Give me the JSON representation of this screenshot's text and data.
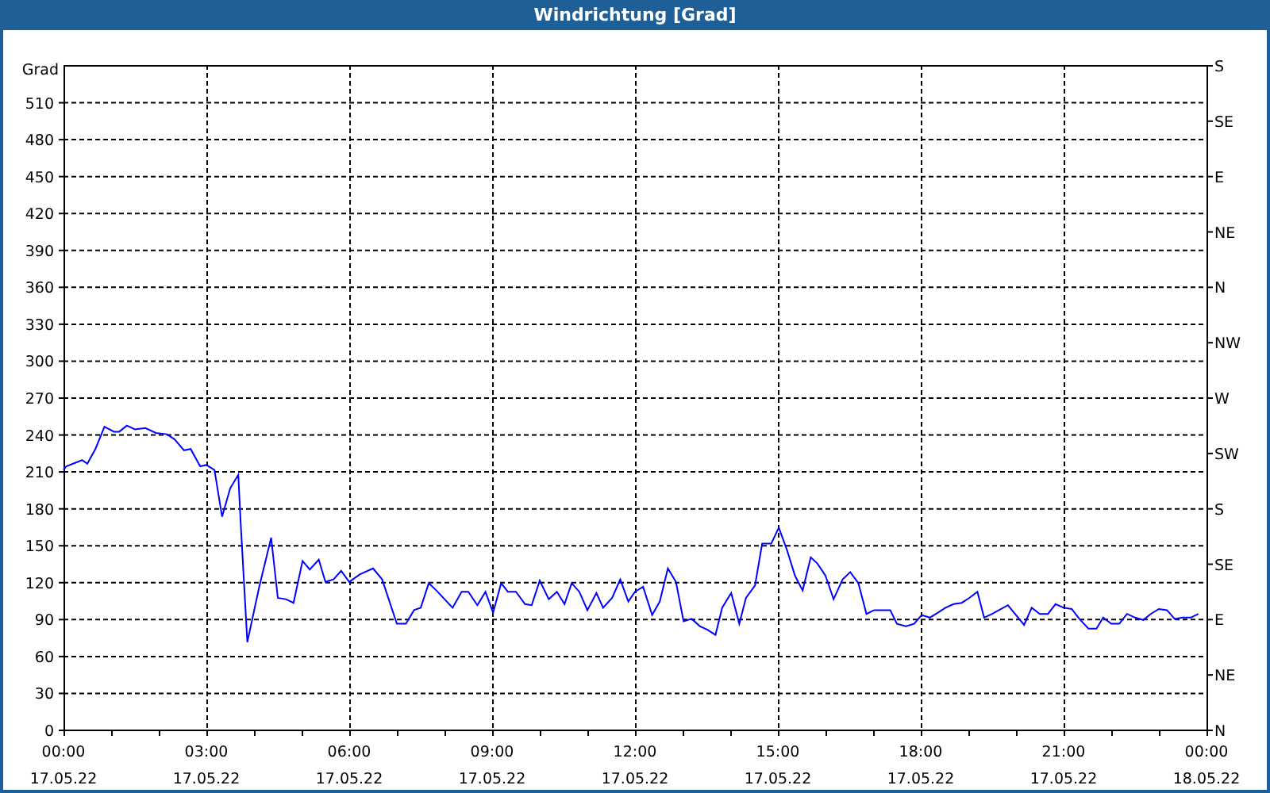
{
  "window": {
    "title": "Windrichtung [Grad]"
  },
  "chart": {
    "x_dates": [
      "17.05.22",
      "17.05.22",
      "17.05.22",
      "17.05.22",
      "17.05.22",
      "17.05.22",
      "17.05.22",
      "17.05.22",
      "18.05.22"
    ],
    "compass_labels": [
      "S",
      "SE",
      "E",
      "NE",
      "N",
      "NW",
      "W",
      "SW",
      "S",
      "SE",
      "E",
      "NE",
      "N"
    ],
    "chart_data": {
      "type": "line",
      "ylabel": "Grad",
      "xlim": [
        0,
        24
      ],
      "ylim": [
        0,
        540
      ],
      "grid": true,
      "xticks": [
        {
          "value": 0,
          "label": "00:00"
        },
        {
          "value": 3,
          "label": "03:00"
        },
        {
          "value": 6,
          "label": "06:00"
        },
        {
          "value": 9,
          "label": "09:00"
        },
        {
          "value": 12,
          "label": "12:00"
        },
        {
          "value": 15,
          "label": "15:00"
        },
        {
          "value": 18,
          "label": "18:00"
        },
        {
          "value": 21,
          "label": "21:00"
        },
        {
          "value": 24,
          "label": "00:00"
        }
      ],
      "yticks": [
        0,
        30,
        60,
        90,
        120,
        150,
        180,
        210,
        240,
        270,
        300,
        330,
        360,
        390,
        420,
        450,
        480,
        510
      ],
      "x": [
        0,
        0.06,
        0.39,
        0.5,
        0.67,
        0.86,
        1.06,
        1.17,
        1.33,
        1.5,
        1.72,
        1.94,
        2.17,
        2.33,
        2.53,
        2.67,
        2.87,
        3.0,
        3.17,
        3.33,
        3.5,
        3.67,
        3.72,
        3.86,
        4.11,
        4.36,
        4.5,
        4.67,
        4.83,
        5.02,
        5.17,
        5.36,
        5.5,
        5.67,
        5.83,
        6.0,
        6.22,
        6.5,
        6.69,
        7.0,
        7.19,
        7.36,
        7.5,
        7.67,
        7.83,
        8.17,
        8.36,
        8.5,
        8.69,
        8.86,
        9.02,
        9.19,
        9.33,
        9.5,
        9.69,
        9.83,
        10.0,
        10.19,
        10.36,
        10.52,
        10.67,
        10.83,
        11.0,
        11.19,
        11.33,
        11.52,
        11.69,
        11.86,
        12.0,
        12.17,
        12.36,
        12.52,
        12.69,
        12.86,
        13.02,
        13.19,
        13.36,
        13.52,
        13.69,
        13.83,
        14.02,
        14.19,
        14.33,
        14.52,
        14.67,
        14.86,
        15.02,
        15.19,
        15.36,
        15.52,
        15.69,
        15.83,
        16.0,
        16.17,
        16.36,
        16.52,
        16.69,
        16.86,
        17.02,
        17.36,
        17.5,
        17.69,
        17.86,
        18.02,
        18.19,
        18.36,
        18.52,
        18.69,
        18.86,
        19.02,
        19.19,
        19.33,
        19.5,
        19.83,
        20.0,
        20.17,
        20.33,
        20.5,
        20.67,
        20.83,
        21.0,
        21.17,
        21.33,
        21.52,
        21.69,
        21.83,
        22.0,
        22.17,
        22.33,
        22.5,
        22.67,
        22.83,
        23.0,
        23.17,
        23.33,
        23.5,
        23.67,
        23.83
      ],
      "values": [
        211,
        214,
        219,
        216,
        228,
        246,
        242,
        242,
        247,
        244,
        245,
        241,
        240,
        236,
        227,
        228,
        214,
        215,
        211,
        173,
        196,
        207,
        168,
        71,
        116,
        156,
        107,
        106,
        103,
        137,
        130,
        138,
        120,
        122,
        129,
        120,
        126,
        131,
        122,
        86,
        86,
        97,
        99,
        119,
        113,
        99,
        112,
        112,
        101,
        112,
        95,
        119,
        112,
        112,
        102,
        101,
        121,
        106,
        112,
        102,
        119,
        112,
        97,
        111,
        99,
        107,
        122,
        104,
        112,
        116,
        93,
        104,
        131,
        120,
        88,
        90,
        84,
        81,
        77,
        99,
        111,
        86,
        107,
        117,
        151,
        151,
        164,
        146,
        125,
        113,
        140,
        135,
        125,
        106,
        122,
        128,
        119,
        94,
        97,
        97,
        86,
        84,
        86,
        93,
        91,
        95,
        99,
        102,
        103,
        107,
        112,
        91,
        94,
        101,
        93,
        85,
        99,
        94,
        94,
        102,
        99,
        98,
        90,
        82,
        82,
        91,
        86,
        86,
        94,
        91,
        89,
        94,
        98,
        97,
        90,
        91,
        91,
        94
      ]
    }
  }
}
